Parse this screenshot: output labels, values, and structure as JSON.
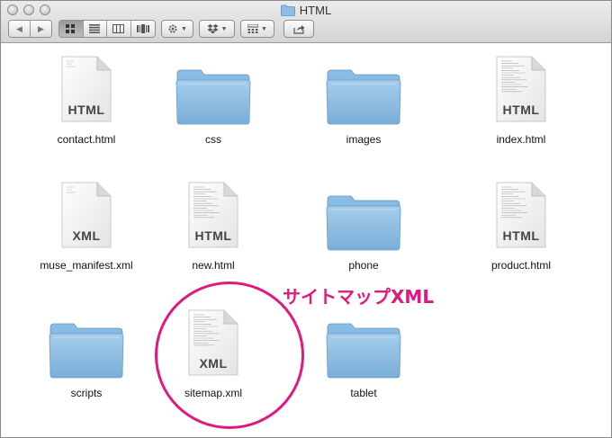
{
  "window": {
    "title": "HTML"
  },
  "toolbar": {
    "back": "◀",
    "forward": "▶"
  },
  "icons": {
    "view_icon": "grid-icon",
    "list_icon": "list-icon",
    "column_icon": "column-icon",
    "coverflow_icon": "coverflow-icon"
  },
  "items": [
    {
      "name": "contact.html",
      "kind": "doc",
      "type_label": "HTML"
    },
    {
      "name": "css",
      "kind": "folder"
    },
    {
      "name": "images",
      "kind": "folder"
    },
    {
      "name": "index.html",
      "kind": "doc",
      "type_label": "HTML"
    },
    {
      "name": "muse_manifest.xml",
      "kind": "doc",
      "type_label": "XML"
    },
    {
      "name": "new.html",
      "kind": "doc",
      "type_label": "HTML"
    },
    {
      "name": "phone",
      "kind": "folder"
    },
    {
      "name": "product.html",
      "kind": "doc",
      "type_label": "HTML"
    },
    {
      "name": "scripts",
      "kind": "folder"
    },
    {
      "name": "sitemap.xml",
      "kind": "doc",
      "type_label": "XML"
    },
    {
      "name": "tablet",
      "kind": "folder"
    }
  ],
  "annotation": {
    "text": "サイトマップXML",
    "color": "#e0197d"
  },
  "colors": {
    "folder": "#7fb3de",
    "accent": "#e0197d"
  }
}
